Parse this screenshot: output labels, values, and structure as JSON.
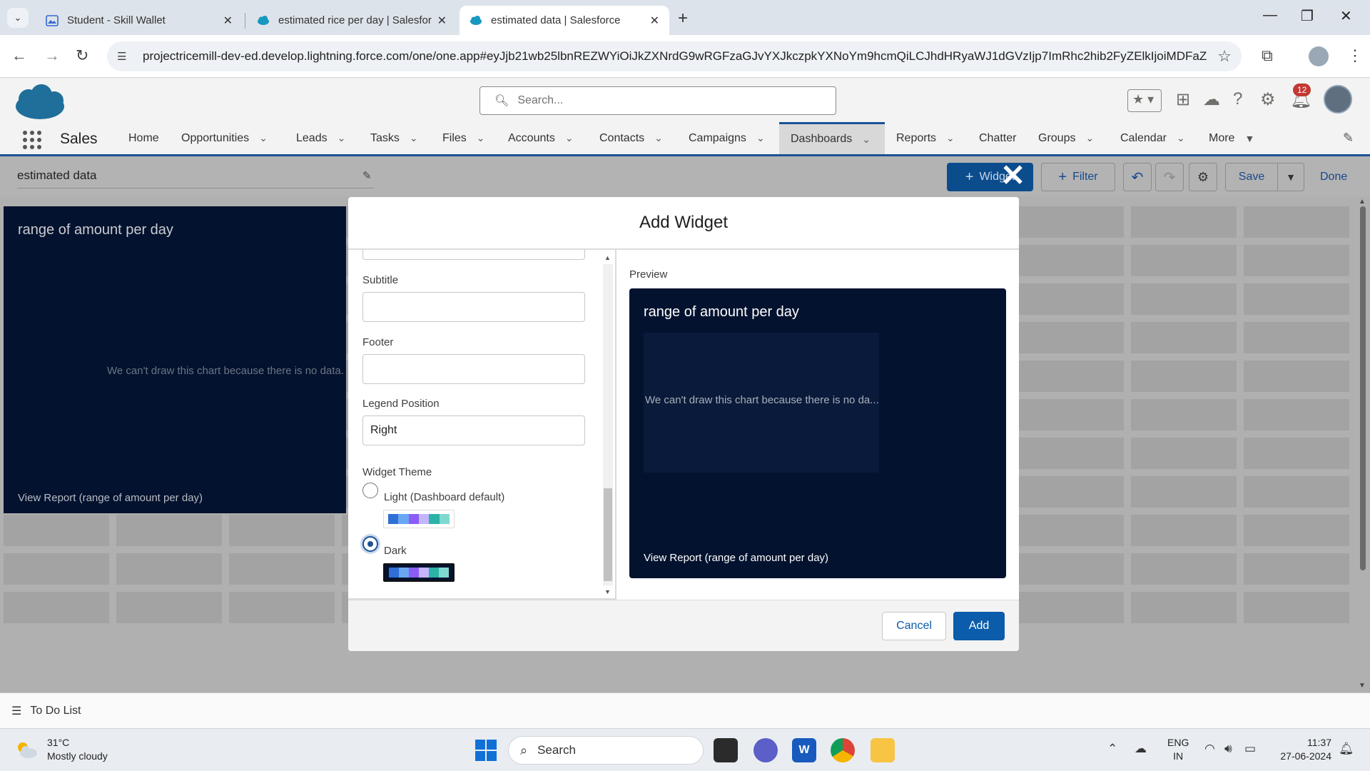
{
  "browser": {
    "tabs": [
      {
        "title": "Student - Skill Wallet",
        "active": false
      },
      {
        "title": "estimated rice per day | Salesfor",
        "active": false
      },
      {
        "title": "estimated data | Salesforce",
        "active": true
      }
    ],
    "url": "projectricemill-dev-ed.develop.lightning.force.com/one/one.app#eyJjb21wb25lbnREZWYiOiJkZXNrdG9wRGFzaGJvYXJkczpkYXNoYm9hcmQiLCJhdHRyaWJ1dGVzIjp7ImRhc2hib2FyZElkIjoiMDFaZ..."
  },
  "sf_header": {
    "search_placeholder": "Search...",
    "notification_count": "12",
    "app_name": "Sales",
    "nav": [
      {
        "label": "Home",
        "has_menu": false
      },
      {
        "label": "Opportunities",
        "has_menu": true
      },
      {
        "label": "Leads",
        "has_menu": true
      },
      {
        "label": "Tasks",
        "has_menu": true
      },
      {
        "label": "Files",
        "has_menu": true
      },
      {
        "label": "Accounts",
        "has_menu": true
      },
      {
        "label": "Contacts",
        "has_menu": true
      },
      {
        "label": "Campaigns",
        "has_menu": true
      },
      {
        "label": "Dashboards",
        "has_menu": true,
        "active": true
      },
      {
        "label": "Reports",
        "has_menu": true
      },
      {
        "label": "Chatter",
        "has_menu": false
      },
      {
        "label": "Groups",
        "has_menu": true
      },
      {
        "label": "Calendar",
        "has_menu": true
      },
      {
        "label": "More",
        "has_menu": true
      }
    ]
  },
  "dashboard": {
    "name": "estimated data",
    "toolbar": {
      "widget_label": "Widget",
      "filter_label": "Filter",
      "save_label": "Save",
      "done_label": "Done"
    },
    "widget": {
      "title": "range of amount per day",
      "message": "We can't draw this chart because there is no data.",
      "link": "View Report (range of amount per day)"
    }
  },
  "modal": {
    "title": "Add Widget",
    "fields": {
      "subtitle_label": "Subtitle",
      "subtitle_value": "",
      "footer_label": "Footer",
      "footer_value": "",
      "legend_label": "Legend Position",
      "legend_value": "Right",
      "theme_label": "Widget Theme",
      "theme_options": [
        {
          "label": "Light (Dashboard default)",
          "selected": false
        },
        {
          "label": "Dark",
          "selected": true
        }
      ]
    },
    "preview": {
      "label": "Preview",
      "title": "range of amount per day",
      "message": "We can't draw this chart because there is no da...",
      "link": "View Report (range of amount per day)"
    },
    "buttons": {
      "cancel": "Cancel",
      "add": "Add"
    }
  },
  "utility_bar": {
    "todo_label": "To Do List"
  },
  "taskbar": {
    "temperature": "31°C",
    "weather": "Mostly cloudy",
    "search_placeholder": "Search",
    "lang_line1": "ENG",
    "lang_line2": "IN",
    "time": "11:37",
    "date": "27-06-2024"
  },
  "colors": {
    "salesforce_blue": "#0b5cab",
    "widget_dark": "#03122e",
    "nav_active_border": "#1b5297",
    "theme_swatch": [
      "#2f6fd6",
      "#6aa7f2",
      "#8b5cf6",
      "#c4b5fd",
      "#2bb3a8",
      "#7fd8cf"
    ]
  }
}
